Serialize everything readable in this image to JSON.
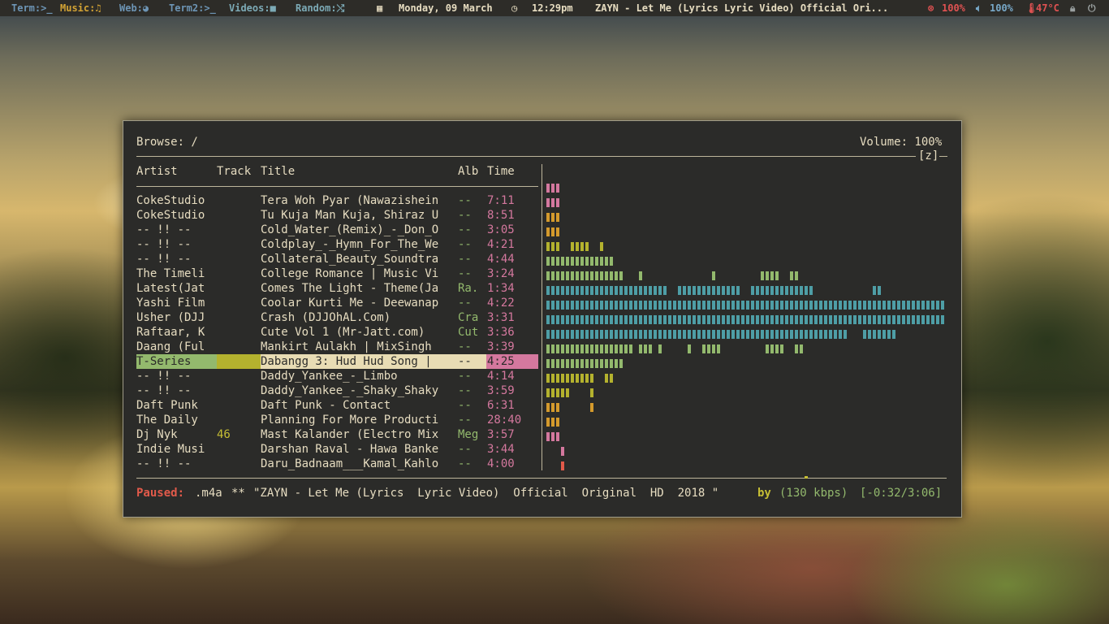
{
  "topbar": {
    "workspaces": [
      {
        "label": "Term:>_",
        "icon": "terminal-icon"
      },
      {
        "label": "Music:♫",
        "icon": "music-icon"
      },
      {
        "label": "Web:◕",
        "icon": "web-icon"
      },
      {
        "label": "Term2:>_",
        "icon": "terminal-icon"
      },
      {
        "label": "Videos:■",
        "icon": "video-icon"
      },
      {
        "label": "Random:⤭",
        "icon": "shuffle-icon"
      }
    ],
    "date": "Monday, 09 March",
    "time": "12:29pm",
    "now_playing": "ZAYN - Let Me (Lyrics  Lyric Video)  Official  Ori...",
    "cpu": "100%",
    "volume": "100%",
    "temp": "47°C",
    "colors": {
      "bar": "#2d2c28",
      "accent_red": "#e05252",
      "accent_blue": "#78a9c9"
    }
  },
  "player": {
    "browse_label": "Browse: /",
    "volume_label": "Volume: 100%",
    "repeat_flag": "[z]",
    "columns": {
      "artist": "Artist",
      "track": "Track",
      "title": "Title",
      "album": "Alb",
      "time": "Time"
    },
    "rows": [
      {
        "artist": "CokeStudio",
        "track": "",
        "title": "Tera Woh Pyar (Nawazishein",
        "album": "--",
        "time": "7:11"
      },
      {
        "artist": "CokeStudio",
        "track": "",
        "title": "Tu Kuja Man Kuja, Shiraz U",
        "album": "--",
        "time": "8:51"
      },
      {
        "artist": "-- !! --",
        "track": "",
        "title": "Cold_Water_(Remix)_-_Don_O",
        "album": "--",
        "time": "3:05"
      },
      {
        "artist": "-- !! --",
        "track": "",
        "title": "Coldplay_-_Hymn_For_The_We",
        "album": "--",
        "time": "4:21"
      },
      {
        "artist": "-- !! --",
        "track": "",
        "title": "Collateral_Beauty_Soundtra",
        "album": "--",
        "time": "4:44"
      },
      {
        "artist": "The Timeli",
        "track": "",
        "title": "College Romance | Music Vi",
        "album": "--",
        "time": "3:24"
      },
      {
        "artist": "Latest(Jat",
        "track": "",
        "title": "Comes The Light - Theme(Ja",
        "album": "Ra.",
        "time": "1:34"
      },
      {
        "artist": "Yashi Film",
        "track": "",
        "title": "Coolar Kurti Me - Deewanap",
        "album": "--",
        "time": "4:22"
      },
      {
        "artist": "Usher (DJJ",
        "track": "",
        "title": "Crash (DJJOhAL.Com)",
        "album": "Cra",
        "time": "3:31"
      },
      {
        "artist": "Raftaar, K",
        "track": "",
        "title": "Cute Vol 1 (Mr-Jatt.com)",
        "album": "Cut",
        "time": "3:36"
      },
      {
        "artist": "Daang (Ful",
        "track": "",
        "title": "Mankirt Aulakh | MixSingh",
        "album": "--",
        "time": "3:39"
      },
      {
        "artist": "T-Series",
        "track": "",
        "title": "Dabangg 3: Hud Hud Song |",
        "album": "--",
        "time": "4:25",
        "selected": true
      },
      {
        "artist": "-- !! --",
        "track": "",
        "title": "Daddy_Yankee_-_Limbo",
        "album": "--",
        "time": "4:14"
      },
      {
        "artist": "-- !! --",
        "track": "",
        "title": "Daddy_Yankee_-_Shaky_Shaky",
        "album": "--",
        "time": "3:59"
      },
      {
        "artist": "Daft Punk",
        "track": "",
        "title": "Daft Punk - Contact",
        "album": "--",
        "time": "6:31"
      },
      {
        "artist": "The Daily",
        "track": "",
        "title": "Planning For More Producti",
        "album": "--",
        "time": "28:40"
      },
      {
        "artist": "Dj Nyk",
        "track": "46",
        "title": "Mast Kalander (Electro Mix",
        "album": "Meg",
        "time": "3:57"
      },
      {
        "artist": "Indie Musi",
        "track": "",
        "title": "Darshan Raval - Hawa Banke",
        "album": "--",
        "time": "3:44"
      },
      {
        "artist": "-- !! --",
        "track": "",
        "title": "Daru_Badnaam___Kamal_Kahlo",
        "album": "--",
        "time": "4:00"
      }
    ],
    "status": {
      "state": "Paused:",
      "format": ".m4a",
      "marker": "**",
      "track": "\"ZAYN - Let Me (Lyrics  Lyric Video)  Official  Original  HD  2018 \"",
      "by": "by",
      "bitrate": "(130 kbps)",
      "position": "[-0:32/3:06]"
    },
    "visualizer_colors": [
      "#d4789e",
      "#d49a2c",
      "#b4b22e",
      "#93b96d",
      "#4e9ea6",
      "#e25a4a"
    ]
  }
}
